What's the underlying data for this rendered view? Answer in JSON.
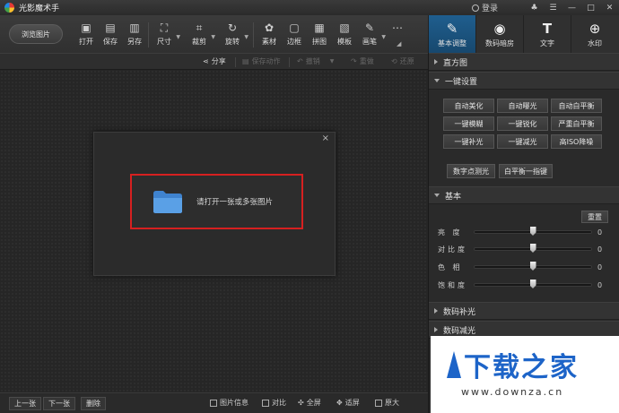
{
  "window": {
    "title": "光影魔术手",
    "login_label": "登录"
  },
  "toolbar": {
    "browse_label": "浏览图片",
    "tools": [
      {
        "label": "打开",
        "icon": "open-image-icon"
      },
      {
        "label": "保存",
        "icon": "save-icon"
      },
      {
        "label": "另存",
        "icon": "save-as-icon"
      },
      {
        "label": "尺寸",
        "icon": "resize-icon"
      },
      {
        "label": "裁剪",
        "icon": "crop-icon"
      },
      {
        "label": "旋转",
        "icon": "rotate-icon"
      },
      {
        "label": "素材",
        "icon": "material-icon"
      },
      {
        "label": "边框",
        "icon": "border-icon"
      },
      {
        "label": "拼图",
        "icon": "collage-icon"
      },
      {
        "label": "模板",
        "icon": "template-icon"
      },
      {
        "label": "画笔",
        "icon": "brush-icon"
      }
    ]
  },
  "right_tabs": [
    {
      "label": "基本调整",
      "icon": "adjust-icon",
      "active": true
    },
    {
      "label": "数码暗房",
      "icon": "darkroom-icon",
      "active": false
    },
    {
      "label": "文字",
      "icon": "text-icon",
      "active": false
    },
    {
      "label": "水印",
      "icon": "watermark-icon",
      "active": false
    }
  ],
  "subbar": {
    "share": "分享",
    "save_action": "保存动作",
    "undo": "撤销",
    "redo": "重做",
    "restore": "还原"
  },
  "open_dialog": {
    "text": "请打开一张或多张图片",
    "close": "×"
  },
  "bottombar": {
    "prev": "上一张",
    "next": "下一张",
    "delete": "删除",
    "image_info": "图片信息",
    "compare": "对比",
    "fullscreen": "全屏",
    "fit_screen": "适屏",
    "original": "原大"
  },
  "panel": {
    "histogram": "直方图",
    "one_click": "一键设置",
    "presets": [
      "自动美化",
      "自动曝光",
      "自动白平衡",
      "一键模糊",
      "一键锐化",
      "严重白平衡",
      "一键补光",
      "一键减光",
      "高ISO降噪"
    ],
    "digital_fill": "数字点测光",
    "white_balance_one": "白平衡一指键",
    "basic": "基本",
    "reset": "重置",
    "sliders": [
      {
        "label": "亮 度",
        "value": "0",
        "fraction": 0.5
      },
      {
        "label": "对比度",
        "value": "0",
        "fraction": 0.5
      },
      {
        "label": "色 相",
        "value": "0",
        "fraction": 0.5
      },
      {
        "label": "饱和度",
        "value": "0",
        "fraction": 0.5
      }
    ],
    "fill_light": "数码补光",
    "reduce_light": "数码减光"
  },
  "watermark": {
    "title": "下载之家",
    "url": "www.downza.cn"
  }
}
